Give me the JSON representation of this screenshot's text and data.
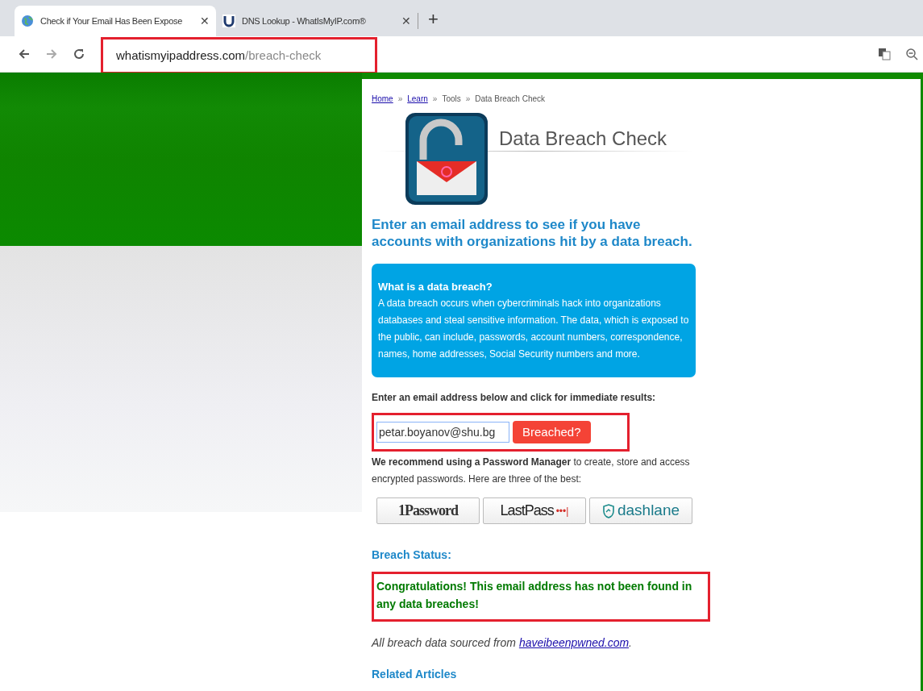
{
  "browser": {
    "tabs": [
      {
        "title": "Check if Your Email Has Been Expose",
        "selected": true,
        "close": "✕"
      },
      {
        "title": "DNS Lookup - WhatIsMyIP.com®",
        "selected": false,
        "close": "✕"
      }
    ],
    "new_tab": "+",
    "address": {
      "domain": "whatismyipaddress.com",
      "path": "/breach-check"
    }
  },
  "page": {
    "breadcrumb": [
      {
        "label": "Home",
        "kind": "link"
      },
      {
        "label": "Learn",
        "kind": "link"
      },
      {
        "label": "Tools",
        "kind": "text"
      },
      {
        "label": "Data Breach Check",
        "kind": "text"
      }
    ],
    "breadcrumb_separator": "»",
    "title": "Data Breach Check",
    "intro": "Enter an email address to see if you have accounts with organizations hit by a data breach.",
    "info_box": {
      "heading": "What is a data breach?",
      "body": "A data breach occurs when cybercriminals hack into organizations databases and steal sensitive information. The data, which is exposed to the public, can include, passwords, account numbers, correspondence, names, home addresses, Social Security numbers and more."
    },
    "form_label": "Enter an email address below and click for immediate results:",
    "email_value": "petar.boyanov@shu.bg",
    "submit": "Breached?",
    "recommend": "**We recommend using a Password Manager** to create, store and access encrypted passwords. Here are three of the best:",
    "managers": [
      {
        "kind": "onepassword",
        "label": "1Password"
      },
      {
        "kind": "lastpass",
        "label": "LastPass",
        "suffix": "•••|"
      },
      {
        "kind": "dashlane",
        "label": "dashlane"
      }
    ],
    "status_heading": "Breach Status:",
    "status_message": "Congratulations! This email address has not been found in any data breaches!",
    "source_text": "All breach data sourced from ",
    "source_link": "haveibeenpwned.com",
    "source_end": ".",
    "related_heading": "Related Articles"
  }
}
